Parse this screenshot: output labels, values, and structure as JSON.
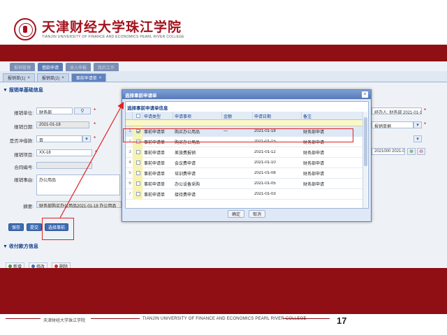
{
  "header": {
    "school_cn": "天津财经大学珠江学院",
    "school_en": "TIANJIN UNIVERSITY OF FINANCE AND ECONOMICS PEARL RIVER COLLEGE"
  },
  "app": {
    "nav_tabs": [
      "报销管理",
      "借款申请",
      "收入申报",
      "我的工作"
    ],
    "doc_tabs": [
      "报销单(1)",
      "报销单(2)",
      "事前申请单"
    ],
    "section_title": "▼ 报销单基础信息",
    "fields": {
      "dept_label": "报销单位:",
      "dept_value": "财务部",
      "date_label": "报销日期:",
      "date_value": "2021-01-18",
      "flag_label": "是否冲借款:",
      "flag_value": "否",
      "project_label": "报销项目:",
      "project_value": "XX-18",
      "contract_label": "合同编号:",
      "contract_value": "",
      "purpose_label": "报销事由:",
      "purpose_value": "办公用品",
      "summary_label": "摘要:",
      "summary_value": "财务部购买办公用品2021-01-18 办公用品"
    },
    "right_fields": {
      "handler": "经办人: 财务部 2021-01-18",
      "type": "报销单据",
      "number": "2021000 2021-01-18"
    },
    "action_buttons": [
      "保存",
      "提交",
      "选择事前"
    ],
    "section_title_2": "▼ 收付款方信息",
    "toolbar": [
      "新增",
      "修改",
      "删除"
    ]
  },
  "modal": {
    "title": "选择事前申请单",
    "grid_caption": "选择事前申请单信息",
    "columns": [
      "申请类型",
      "申请事项",
      "金额",
      "申请日期",
      "备注"
    ],
    "rows": [
      {
        "num": "1",
        "checked": true,
        "type": "事前申请单",
        "desc": "购买办公用品",
        "amt": "—",
        "date": "2021-01-18",
        "note": "财务部申请"
      },
      {
        "num": "2",
        "checked": false,
        "type": "事前申请单",
        "desc": "购买办公用品",
        "amt": "",
        "date": "2021-01-15",
        "note": "财务部申请"
      },
      {
        "num": "3",
        "checked": false,
        "type": "事前申请单",
        "desc": "差旅费报销",
        "amt": "",
        "date": "2021-01-12",
        "note": "财务部申请"
      },
      {
        "num": "4",
        "checked": false,
        "type": "事前申请单",
        "desc": "会议费申请",
        "amt": "",
        "date": "2021-01-10",
        "note": "财务部申请"
      },
      {
        "num": "5",
        "checked": false,
        "type": "事前申请单",
        "desc": "培训费申请",
        "amt": "",
        "date": "2021-01-08",
        "note": "财务部申请"
      },
      {
        "num": "6",
        "checked": false,
        "type": "事前申请单",
        "desc": "办公设备采购",
        "amt": "",
        "date": "2021-01-05",
        "note": "财务部申请"
      },
      {
        "num": "7",
        "checked": false,
        "type": "事前申请单",
        "desc": "接待费申请",
        "amt": "",
        "date": "2021-01-03",
        "note": ""
      }
    ],
    "ok_label": "确定",
    "cancel_label": "取消"
  },
  "footer": {
    "cn": "天津财经大学珠江学院",
    "en": "TIANJIN UNIVERSITY OF FINANCE AND ECONOMICS PEARL RIVER COLLEGE",
    "page": "17"
  },
  "colors": {
    "brand_red": "#8f0f14",
    "callout_red": "#e02020",
    "ui_blue": "#3f6db3"
  }
}
